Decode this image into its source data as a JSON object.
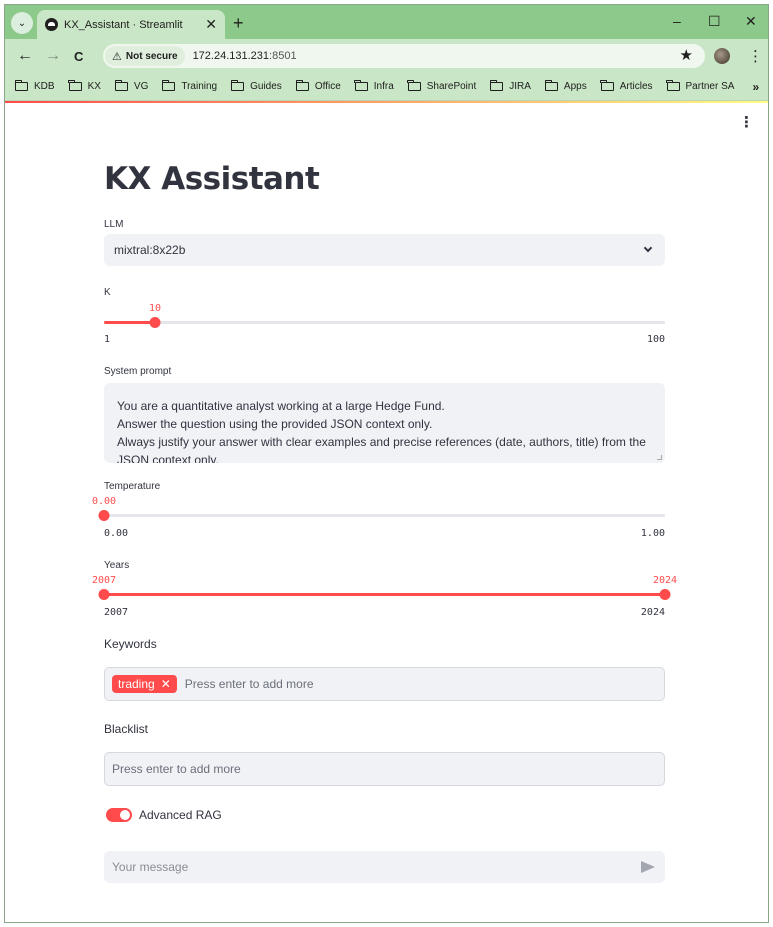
{
  "browser": {
    "tab_title": "KX_Assistant · Streamlit",
    "tab_close": "✕",
    "new_tab": "+",
    "window_controls": {
      "minimize": "–",
      "maximize": "☐",
      "close": "✕"
    },
    "nav": {
      "back": "←",
      "forward": "→",
      "reload": "C"
    },
    "security_label": "Not secure",
    "url_host": "172.24.131.231",
    "url_port": ":8501",
    "bookmarks": [
      "KDB",
      "KX",
      "VG",
      "Training",
      "Guides",
      "Office",
      "Infra",
      "SharePoint",
      "JIRA",
      "Apps",
      "Articles",
      "Partner SA"
    ],
    "bookmarks_more": "»"
  },
  "app": {
    "title": "KX Assistant",
    "llm": {
      "label": "LLM",
      "value": "mixtral:8x22b"
    },
    "k": {
      "label": "K",
      "value": "10",
      "min": "1",
      "max": "100",
      "fraction": 0.0909
    },
    "system_prompt": {
      "label": "System prompt",
      "lines": [
        "You are a quantitative analyst working at a large Hedge Fund.",
        "Answer the question using the provided JSON context only.",
        "Always justify your answer with clear examples and precise references (date, authors, title) from the",
        "JSON context only."
      ]
    },
    "temperature": {
      "label": "Temperature",
      "value": "0.00",
      "min": "0.00",
      "max": "1.00",
      "fraction": 0
    },
    "years": {
      "label": "Years",
      "low": "2007",
      "high": "2024",
      "min": "2007",
      "max": "2024",
      "low_fraction": 0,
      "high_fraction": 1
    },
    "keywords": {
      "label": "Keywords",
      "tags": [
        "trading"
      ],
      "placeholder": "Press enter to add more"
    },
    "blacklist": {
      "label": "Blacklist",
      "placeholder": "Press enter to add more"
    },
    "advanced_rag": {
      "label": "Advanced RAG",
      "enabled": true
    },
    "chat": {
      "placeholder": "Your message"
    },
    "accent_color": "#ff4b4b"
  }
}
